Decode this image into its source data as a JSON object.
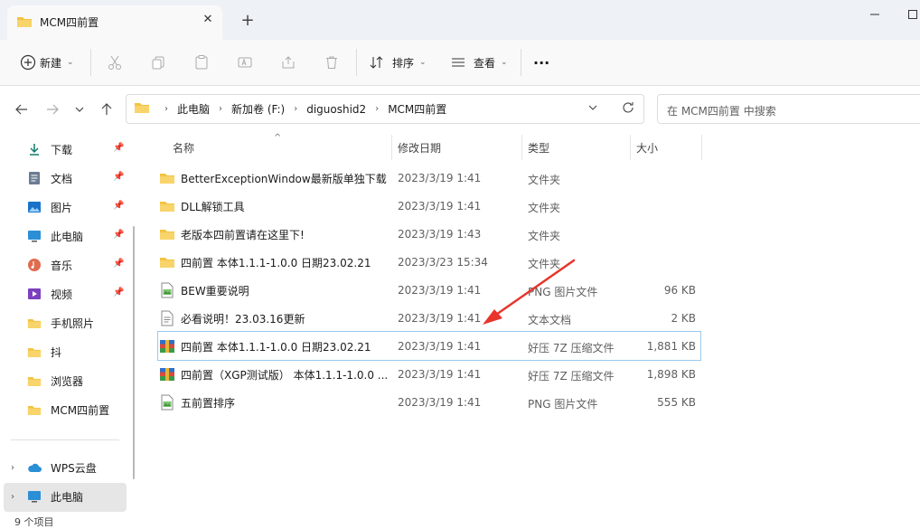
{
  "window": {
    "tab_title": "MCM四前置",
    "close_tab": "✕",
    "new_tab": "+"
  },
  "toolbar": {
    "new_label": "新建",
    "sort_label": "排序",
    "view_label": "查看",
    "more_label": "···"
  },
  "address": {
    "crumbs": [
      "此电脑",
      "新加卷 (F:)",
      "diguoshid2",
      "MCM四前置"
    ],
    "search_placeholder": "在 MCM四前置 中搜索"
  },
  "nav": {
    "items": [
      {
        "label": "下载",
        "icon": "download-icon",
        "pinned": true
      },
      {
        "label": "文档",
        "icon": "document-icon",
        "pinned": true
      },
      {
        "label": "图片",
        "icon": "picture-icon",
        "pinned": true
      },
      {
        "label": "此电脑",
        "icon": "computer-icon",
        "pinned": true
      },
      {
        "label": "音乐",
        "icon": "music-icon",
        "pinned": true
      },
      {
        "label": "视频",
        "icon": "video-icon",
        "pinned": true
      },
      {
        "label": "手机照片",
        "icon": "folder-icon",
        "pinned": false
      },
      {
        "label": "抖",
        "icon": "folder-icon",
        "pinned": false
      },
      {
        "label": "浏览器",
        "icon": "folder-icon",
        "pinned": false
      },
      {
        "label": "MCM四前置",
        "icon": "folder-icon",
        "pinned": false
      }
    ],
    "groups": [
      {
        "label": "WPS云盘",
        "icon": "cloud-icon"
      },
      {
        "label": "此电脑",
        "icon": "computer-icon"
      }
    ]
  },
  "columns": {
    "name": "名称",
    "date": "修改日期",
    "type": "类型",
    "size": "大小"
  },
  "files": [
    {
      "name": "BetterExceptionWindow最新版单独下载",
      "date": "2023/3/19 1:41",
      "type": "文件夹",
      "size": "",
      "icon": "folder-icon"
    },
    {
      "name": "DLL解锁工具",
      "date": "2023/3/19 1:41",
      "type": "文件夹",
      "size": "",
      "icon": "folder-icon"
    },
    {
      "name": "老版本四前置请在这里下!",
      "date": "2023/3/19 1:43",
      "type": "文件夹",
      "size": "",
      "icon": "folder-icon"
    },
    {
      "name": "四前置 本体1.1.1-1.0.0 日期23.02.21",
      "date": "2023/3/23 15:34",
      "type": "文件夹",
      "size": "",
      "icon": "folder-icon"
    },
    {
      "name": "BEW重要说明",
      "date": "2023/3/19 1:41",
      "type": "PNG 图片文件",
      "size": "96 KB",
      "icon": "png-icon"
    },
    {
      "name": "必看说明！23.03.16更新",
      "date": "2023/3/19 1:41",
      "type": "文本文档",
      "size": "2 KB",
      "icon": "text-file-icon"
    },
    {
      "name": "四前置 本体1.1.1-1.0.0 日期23.02.21",
      "date": "2023/3/19 1:41",
      "type": "好压 7Z 压缩文件",
      "size": "1,881 KB",
      "icon": "archive-icon"
    },
    {
      "name": "四前置（XGP测试版） 本体1.1.1-1.0.0 ...",
      "date": "2023/3/19 1:41",
      "type": "好压 7Z 压缩文件",
      "size": "1,898 KB",
      "icon": "archive-icon"
    },
    {
      "name": "五前置排序",
      "date": "2023/3/19 1:41",
      "type": "PNG 图片文件",
      "size": "555 KB",
      "icon": "png-icon"
    }
  ],
  "status": {
    "item_count": "9 个项目"
  },
  "colors": {
    "folder": "#f3c342",
    "accent": "#0067c0",
    "arrow": "#e8342a"
  }
}
